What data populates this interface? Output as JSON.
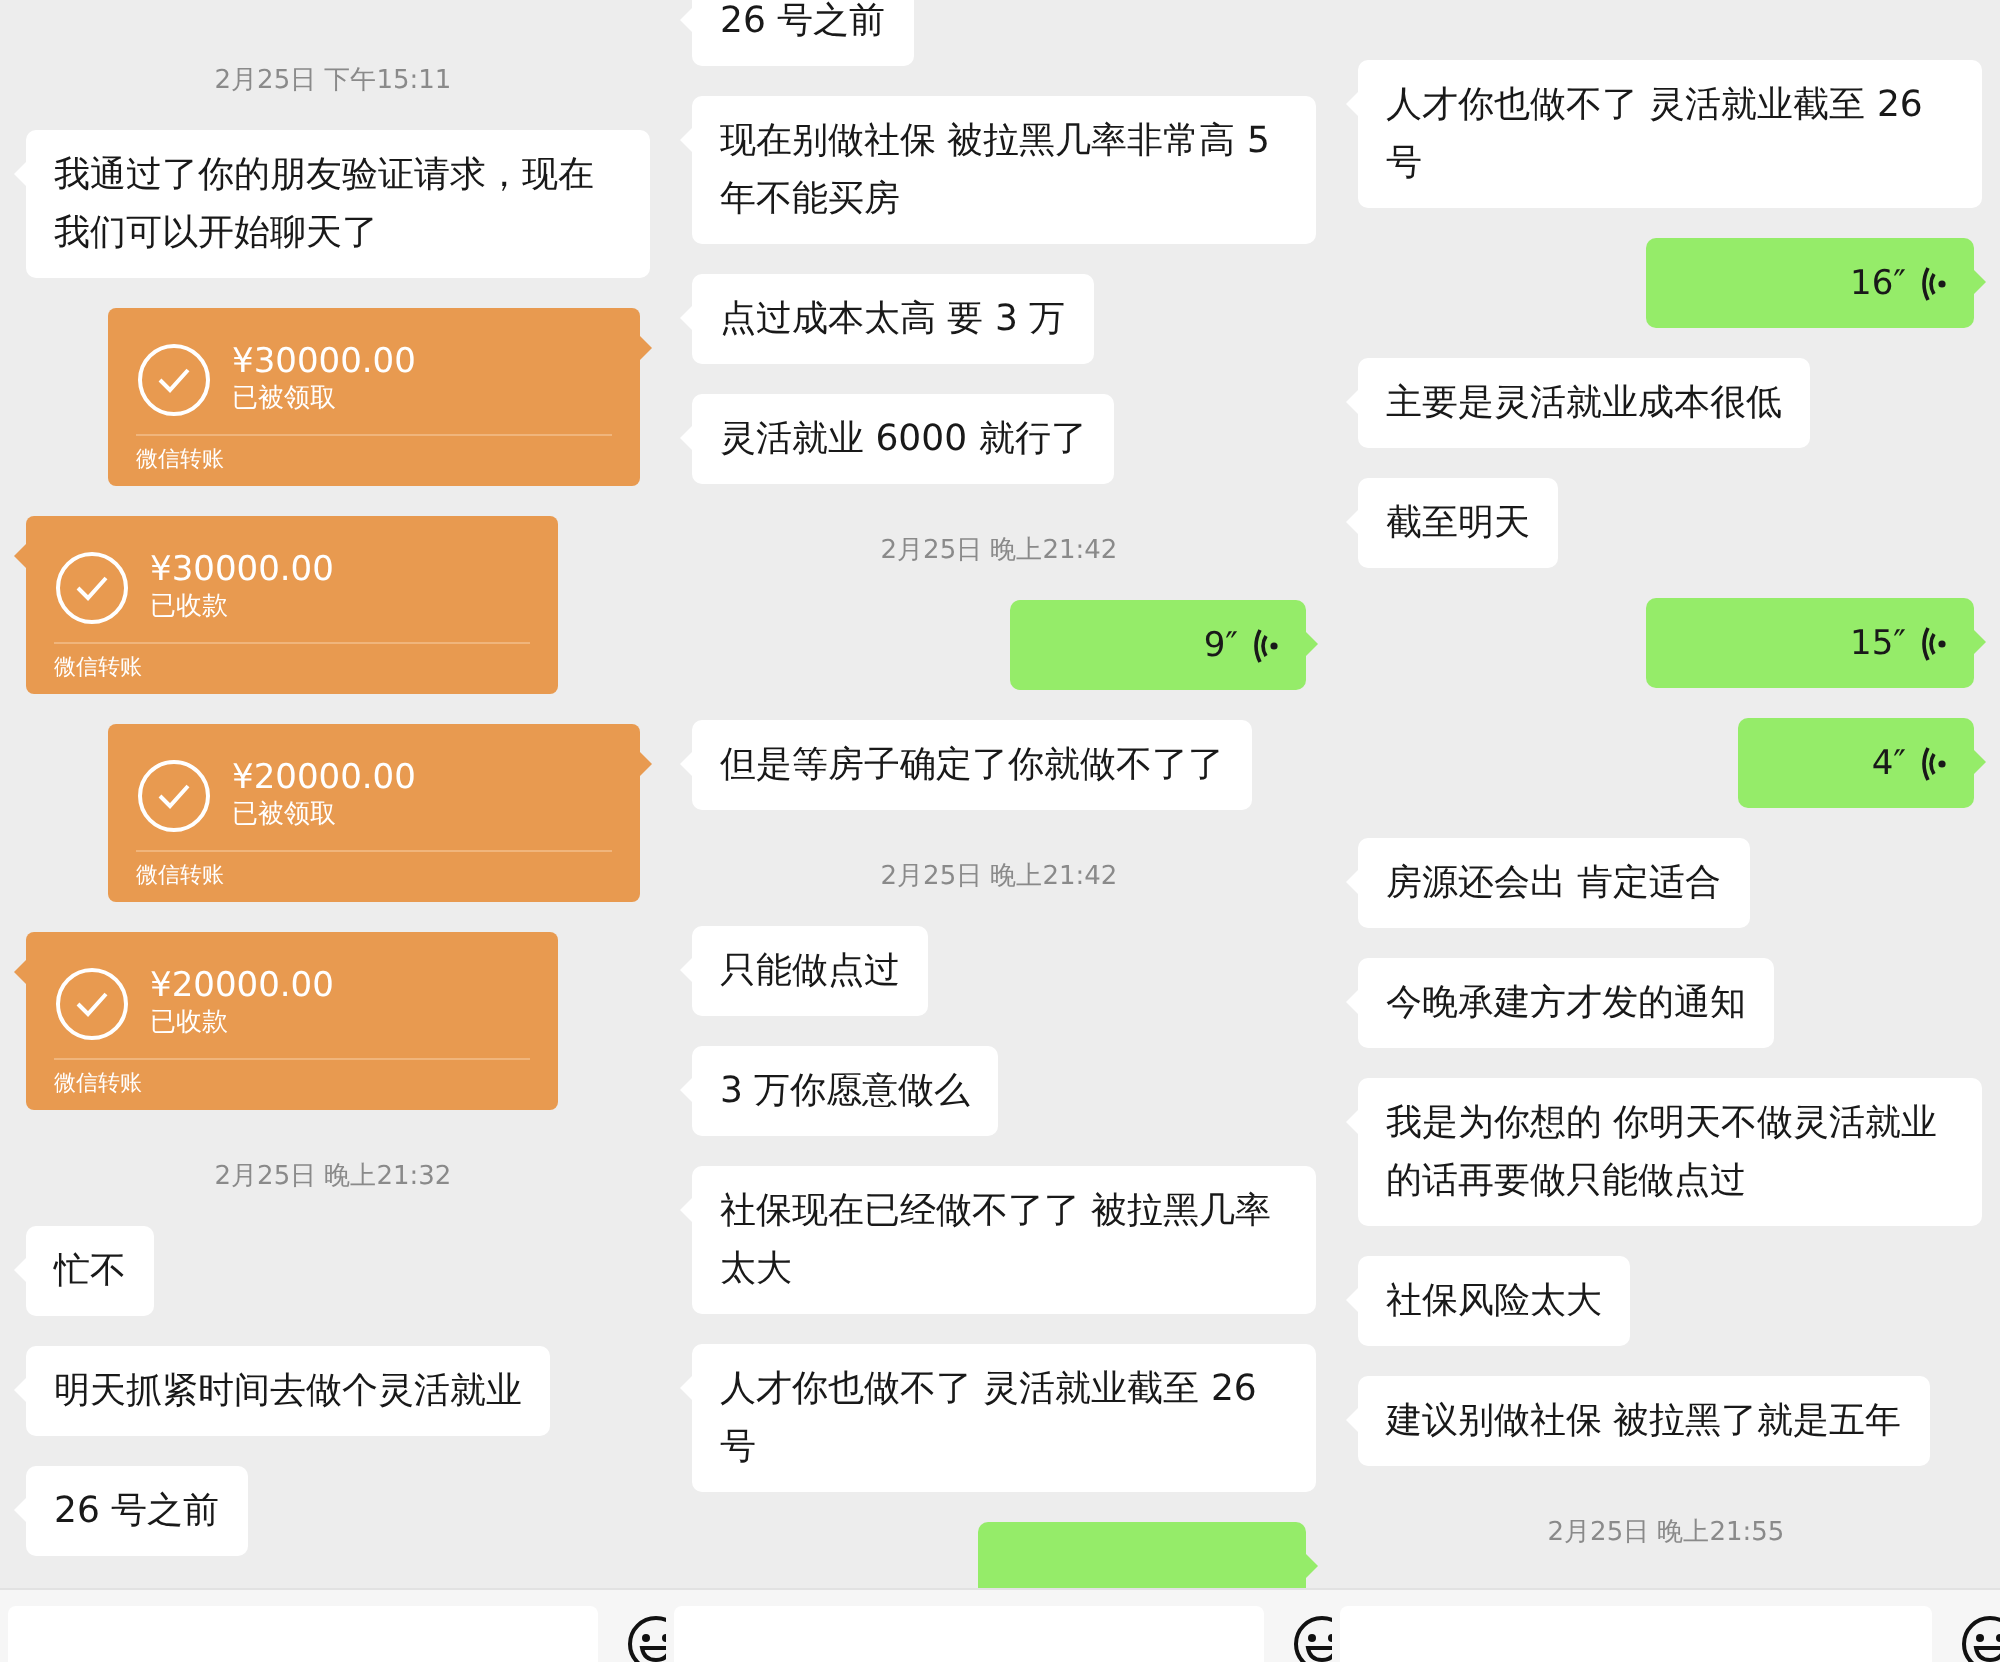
{
  "panels": [
    {
      "cut_top": false,
      "cut_bottom": false,
      "messages": [
        {
          "kind": "time",
          "text": "2月25日 下午15:11"
        },
        {
          "kind": "text",
          "outgoing": false,
          "text": "我通过了你的朋友验证请求，现在我们可以开始聊天了"
        },
        {
          "kind": "transfer",
          "outgoing": true,
          "amount": "¥30000.00",
          "status": "已被领取",
          "footer": "微信转账"
        },
        {
          "kind": "transfer",
          "outgoing": false,
          "amount": "¥30000.00",
          "status": "已收款",
          "footer": "微信转账"
        },
        {
          "kind": "transfer",
          "outgoing": true,
          "amount": "¥20000.00",
          "status": "已被领取",
          "footer": "微信转账"
        },
        {
          "kind": "transfer",
          "outgoing": false,
          "amount": "¥20000.00",
          "status": "已收款",
          "footer": "微信转账"
        },
        {
          "kind": "time",
          "text": "2月25日 晚上21:32"
        },
        {
          "kind": "text",
          "outgoing": false,
          "text": "忙不"
        },
        {
          "kind": "text",
          "outgoing": false,
          "text": "明天抓紧时间去做个灵活就业"
        },
        {
          "kind": "text",
          "outgoing": false,
          "text": "26 号之前"
        }
      ]
    },
    {
      "cut_top": true,
      "cut_bottom": true,
      "messages": [
        {
          "kind": "text",
          "outgoing": false,
          "text": "26 号之前"
        },
        {
          "kind": "text",
          "outgoing": false,
          "text": "现在别做社保 被拉黑几率非常高 5 年不能买房"
        },
        {
          "kind": "text",
          "outgoing": false,
          "text": "点过成本太高 要 3 万"
        },
        {
          "kind": "text",
          "outgoing": false,
          "text": "灵活就业 6000 就行了"
        },
        {
          "kind": "time",
          "text": "2月25日 晚上21:42"
        },
        {
          "kind": "voice",
          "outgoing": true,
          "duration": "9″"
        },
        {
          "kind": "text",
          "outgoing": false,
          "text": "但是等房子确定了你就做不了了"
        },
        {
          "kind": "time",
          "text": "2月25日 晚上21:42"
        },
        {
          "kind": "text",
          "outgoing": false,
          "text": "只能做点过"
        },
        {
          "kind": "text",
          "outgoing": false,
          "text": "3 万你愿意做么"
        },
        {
          "kind": "text",
          "outgoing": false,
          "text": "社保现在已经做不了了 被拉黑几率太大"
        },
        {
          "kind": "text",
          "outgoing": false,
          "text": "人才你也做不了 灵活就业截至 26 号"
        },
        {
          "kind": "voice",
          "outgoing": true
        }
      ]
    },
    {
      "cut_top": true,
      "cut_bottom": false,
      "messages": [
        {
          "kind": "text",
          "outgoing": false,
          "text": "人才你也做不了 灵活就业截至 26 号"
        },
        {
          "kind": "voice",
          "outgoing": true,
          "duration": "16″"
        },
        {
          "kind": "text",
          "outgoing": false,
          "text": "主要是灵活就业成本很低"
        },
        {
          "kind": "text",
          "outgoing": false,
          "text": "截至明天"
        },
        {
          "kind": "voice",
          "outgoing": true,
          "duration": "15″"
        },
        {
          "kind": "voice",
          "outgoing": true,
          "duration": "4″"
        },
        {
          "kind": "text",
          "outgoing": false,
          "text": "房源还会出 肯定适合"
        },
        {
          "kind": "text",
          "outgoing": false,
          "text": "今晚承建方才发的通知"
        },
        {
          "kind": "text",
          "outgoing": false,
          "text": "我是为你想的 你明天不做灵活就业的话再要做只能做点过"
        },
        {
          "kind": "text",
          "outgoing": false,
          "text": "社保风险太大"
        },
        {
          "kind": "text",
          "outgoing": false,
          "text": "建议别做社保 被拉黑了就是五年"
        },
        {
          "kind": "time",
          "text": "2月25日 晚上21:55"
        }
      ]
    }
  ]
}
